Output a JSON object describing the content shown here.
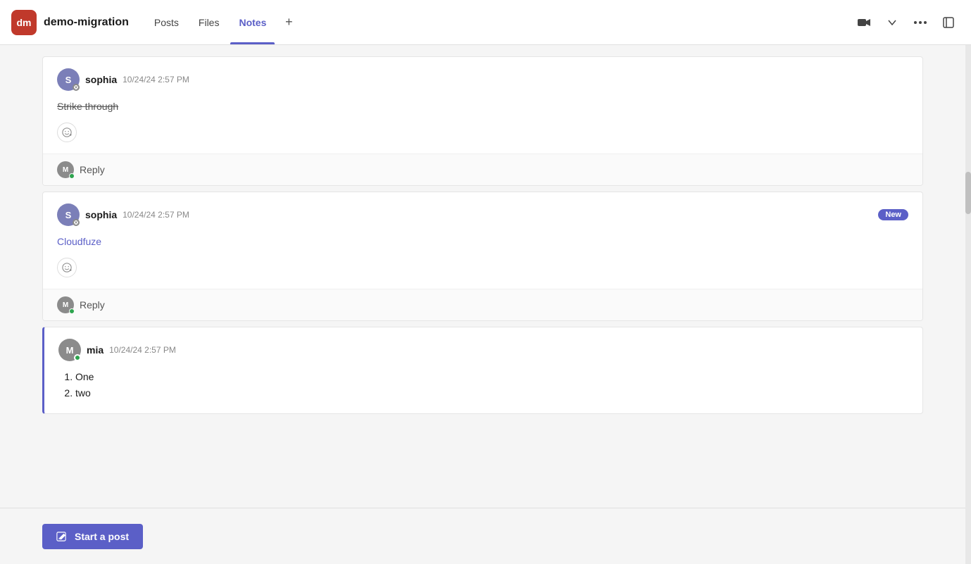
{
  "header": {
    "app_icon_text": "dm",
    "app_title": "demo-migration",
    "nav_tabs": [
      {
        "id": "posts",
        "label": "Posts",
        "active": true
      },
      {
        "id": "files",
        "label": "Files",
        "active": false
      },
      {
        "id": "notes",
        "label": "Notes",
        "active": false
      }
    ],
    "plus_label": "+",
    "icons": {
      "video": "📹",
      "chevron": "⌄",
      "more": "···",
      "expand": "⤢"
    }
  },
  "posts": [
    {
      "id": "post1",
      "author_initial": "S",
      "author_name": "sophia",
      "timestamp": "10/24/24 2:57 PM",
      "avatar_type": "s",
      "status_type": "x",
      "content_type": "strikethrough",
      "content_text": "Strike through",
      "has_new_badge": false,
      "has_reply": true,
      "reply_author_initial": "M"
    },
    {
      "id": "post2",
      "author_initial": "S",
      "author_name": "sophia",
      "timestamp": "10/24/24 2:57 PM",
      "avatar_type": "s",
      "status_type": "x",
      "content_type": "link",
      "content_text": "Cloudfuze",
      "content_href": "#",
      "has_new_badge": true,
      "new_badge_label": "New",
      "has_reply": true,
      "reply_author_initial": "M"
    },
    {
      "id": "post3",
      "author_initial": "M",
      "author_name": "mia",
      "timestamp": "10/24/24 2:57 PM",
      "avatar_type": "m",
      "status_type": "green",
      "content_type": "list",
      "list_items": [
        "One",
        "two"
      ],
      "has_new_badge": false,
      "has_reply": false,
      "accent_left": true
    }
  ],
  "start_post_button": {
    "label": "Start a post",
    "icon": "✏"
  },
  "reply_label": "Reply",
  "emoji_tooltip": "Add reaction"
}
